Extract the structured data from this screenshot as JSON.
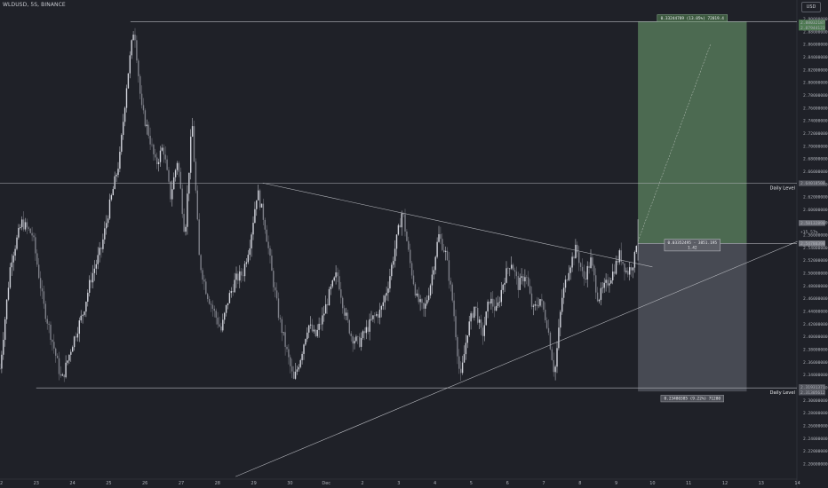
{
  "header": {
    "symbol": "WLDUSD, 5S, BINANCE",
    "currency": "USD"
  },
  "chart_data": {
    "type": "candlestick",
    "y_ticks": [
      "2.92000000",
      "2.90000000",
      "2.88000000",
      "2.86000000",
      "2.84000000",
      "2.82000000",
      "2.80000000",
      "2.78000000",
      "2.76000000",
      "2.74000000",
      "2.72000000",
      "2.70000000",
      "2.68000000",
      "2.66000000",
      "2.64000000",
      "2.62000000",
      "2.60000000",
      "2.58000000",
      "2.56000000",
      "2.54000000",
      "2.52000000",
      "2.50000000",
      "2.48000000",
      "2.46000000",
      "2.44000000",
      "2.42000000",
      "2.40000000",
      "2.38000000",
      "2.36000000",
      "2.34000000",
      "2.32000000",
      "2.30000000",
      "2.28000000",
      "2.26000000",
      "2.24000000",
      "2.22000000",
      "2.20000000",
      "2.18000000"
    ],
    "x_ticks": [
      {
        "label": "22",
        "t": 0
      },
      {
        "label": "23",
        "t": 1
      },
      {
        "label": "24",
        "t": 2
      },
      {
        "label": "25",
        "t": 3
      },
      {
        "label": "26",
        "t": 4
      },
      {
        "label": "27",
        "t": 5
      },
      {
        "label": "28",
        "t": 6
      },
      {
        "label": "29",
        "t": 7
      },
      {
        "label": "30",
        "t": 8
      },
      {
        "label": "Dec",
        "t": 9
      },
      {
        "label": "2",
        "t": 10
      },
      {
        "label": "3",
        "t": 11
      },
      {
        "label": "4",
        "t": 12
      },
      {
        "label": "5",
        "t": 13
      },
      {
        "label": "6",
        "t": 14
      },
      {
        "label": "7",
        "t": 15
      },
      {
        "label": "8",
        "t": 16
      },
      {
        "label": "9",
        "t": 17
      },
      {
        "label": "10",
        "t": 18
      },
      {
        "label": "11",
        "t": 19
      },
      {
        "label": "12",
        "t": 20
      },
      {
        "label": "13",
        "t": 21
      },
      {
        "label": "14",
        "t": 22
      }
    ],
    "ylim": [
      2.176,
      2.93
    ],
    "price_path": [
      [
        0.0,
        2.35
      ],
      [
        0.3,
        2.52
      ],
      [
        0.6,
        2.58
      ],
      [
        0.9,
        2.56
      ],
      [
        1.2,
        2.45
      ],
      [
        1.5,
        2.38
      ],
      [
        1.7,
        2.33
      ],
      [
        2.0,
        2.39
      ],
      [
        2.3,
        2.44
      ],
      [
        2.5,
        2.49
      ],
      [
        2.8,
        2.54
      ],
      [
        3.0,
        2.6
      ],
      [
        3.3,
        2.68
      ],
      [
        3.5,
        2.8
      ],
      [
        3.7,
        2.89
      ],
      [
        3.9,
        2.76
      ],
      [
        4.1,
        2.72
      ],
      [
        4.3,
        2.67
      ],
      [
        4.5,
        2.7
      ],
      [
        4.7,
        2.62
      ],
      [
        4.9,
        2.68
      ],
      [
        5.1,
        2.56
      ],
      [
        5.3,
        2.74
      ],
      [
        5.5,
        2.52
      ],
      [
        5.7,
        2.47
      ],
      [
        5.9,
        2.44
      ],
      [
        6.1,
        2.41
      ],
      [
        6.3,
        2.46
      ],
      [
        6.5,
        2.49
      ],
      [
        6.7,
        2.5
      ],
      [
        6.9,
        2.55
      ],
      [
        7.1,
        2.63
      ],
      [
        7.3,
        2.58
      ],
      [
        7.5,
        2.5
      ],
      [
        7.7,
        2.43
      ],
      [
        7.9,
        2.38
      ],
      [
        8.1,
        2.33
      ],
      [
        8.3,
        2.37
      ],
      [
        8.5,
        2.42
      ],
      [
        8.7,
        2.4
      ],
      [
        8.9,
        2.43
      ],
      [
        9.1,
        2.47
      ],
      [
        9.3,
        2.5
      ],
      [
        9.5,
        2.44
      ],
      [
        9.7,
        2.4
      ],
      [
        9.9,
        2.39
      ],
      [
        10.1,
        2.41
      ],
      [
        10.3,
        2.43
      ],
      [
        10.5,
        2.44
      ],
      [
        10.7,
        2.48
      ],
      [
        10.9,
        2.54
      ],
      [
        11.1,
        2.6
      ],
      [
        11.3,
        2.52
      ],
      [
        11.5,
        2.46
      ],
      [
        11.7,
        2.44
      ],
      [
        11.9,
        2.49
      ],
      [
        12.1,
        2.56
      ],
      [
        12.3,
        2.53
      ],
      [
        12.5,
        2.45
      ],
      [
        12.7,
        2.33
      ],
      [
        12.9,
        2.41
      ],
      [
        13.1,
        2.45
      ],
      [
        13.3,
        2.4
      ],
      [
        13.5,
        2.46
      ],
      [
        13.7,
        2.44
      ],
      [
        13.9,
        2.49
      ],
      [
        14.1,
        2.52
      ],
      [
        14.3,
        2.48
      ],
      [
        14.5,
        2.5
      ],
      [
        14.7,
        2.44
      ],
      [
        14.9,
        2.46
      ],
      [
        15.1,
        2.42
      ],
      [
        15.3,
        2.34
      ],
      [
        15.5,
        2.46
      ],
      [
        15.7,
        2.51
      ],
      [
        15.9,
        2.54
      ],
      [
        16.1,
        2.49
      ],
      [
        16.3,
        2.52
      ],
      [
        16.5,
        2.46
      ],
      [
        16.7,
        2.48
      ],
      [
        16.9,
        2.5
      ],
      [
        17.1,
        2.53
      ],
      [
        17.3,
        2.5
      ],
      [
        17.5,
        2.52
      ],
      [
        17.6,
        2.571
      ]
    ],
    "horizontal_lines": [
      {
        "name": "top",
        "price": 2.896
      },
      {
        "name": "daily-upper",
        "price": 2.6415,
        "label": "Daily Level"
      },
      {
        "name": "daily-lower",
        "price": 2.3196,
        "label": "Daily Level"
      }
    ],
    "trendlines": [
      {
        "name": "descending",
        "from": [
          7.25,
          2.642
        ],
        "to": [
          18.0,
          2.51
        ]
      },
      {
        "name": "ascending",
        "from": [
          6.5,
          2.18
        ],
        "to": [
          22.0,
          2.55
        ]
      }
    ],
    "position": {
      "t_start": 17.6,
      "t_end": 20.6,
      "entry": 2.547,
      "target": 2.896,
      "stop": 2.314,
      "target_label": "0.33244789 (13.05%) 72019.4",
      "entry_label_1": "0.03352495 - 3851.195",
      "entry_label_2": "1.42",
      "stop_label": "0.23480385 (9.22%) 71280",
      "target_tags": [
        "2.88032187",
        "2.87944123"
      ],
      "stop_tags": [
        "2.31931371",
        "2.31305612"
      ],
      "arrow_to": [
        19.6,
        2.86
      ]
    },
    "price_tags": [
      "2.58132890",
      "+15.57%",
      "2.54780398"
    ],
    "level_tag": "2.64018500",
    "colors": {
      "bg": "#1f2128",
      "up": "#d2d4dc",
      "down": "#7d7f88",
      "reward": "#5f8a63",
      "risk": "#565862",
      "line": "#9a9ca3"
    }
  }
}
